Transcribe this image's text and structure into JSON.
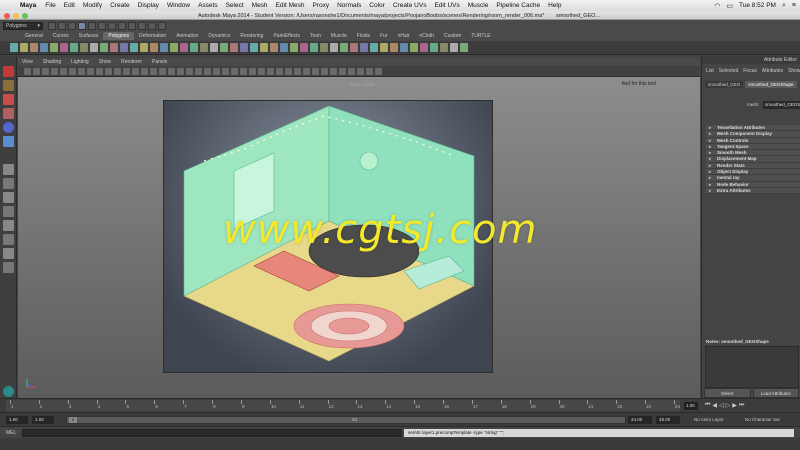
{
  "mac_menubar": {
    "app": "Maya",
    "items": [
      "File",
      "Edit",
      "Modify",
      "Create",
      "Display",
      "Window",
      "Assets",
      "Select",
      "Mesh",
      "Edit Mesh",
      "Proxy",
      "Normals",
      "Color",
      "Create UVs",
      "Edit UVs",
      "Muscle",
      "Pipeline Cache",
      "Help"
    ],
    "clock": "Tue 8:52 PM"
  },
  "window": {
    "title": "Autodesk Maya 2014 - Student Version: /Users/rasonshe1/Documents/maya/projects/PoojanoBoobs/scenes/Rendering/room_render_006.ma*",
    "title_suffix": "smoothed_GEO..."
  },
  "menuset": {
    "selected": "Polygons"
  },
  "shelf": {
    "tabs": [
      "General",
      "Curves",
      "Surfaces",
      "Polygons",
      "Deformation",
      "Animation",
      "Dynamics",
      "Rendering",
      "PaintEffects",
      "Toon",
      "Muscle",
      "Fluids",
      "Fur",
      "nHair",
      "nCloth",
      "Custom",
      "TURTLE"
    ],
    "active_tab": "Polygons"
  },
  "viewport": {
    "menu": [
      "View",
      "Shading",
      "Lighting",
      "Show",
      "Renderer",
      "Panels"
    ],
    "resolution": "1024 x 1024",
    "tool_hint": "fied for this tool",
    "watermark": "www.cgtsj.com"
  },
  "attribute_editor": {
    "title": "Attribute Editor",
    "menu": [
      "List",
      "Selected",
      "Focus",
      "Attributes",
      "Show"
    ],
    "tabs": [
      "smoothed_GEO",
      "smoothed_GEOShape"
    ],
    "active_tab": "smoothed_GEOShape",
    "mesh_label": "mesh:",
    "mesh_value": "smoothed_GEOSh",
    "sections": [
      "Tessellation Attributes",
      "Mesh Component Display",
      "Mesh Controls",
      "Tangent Space",
      "Smooth Mesh",
      "Displacement Map",
      "Render Stats",
      "Object Display",
      "mental ray",
      "Node Behavior",
      "Extra Attributes"
    ],
    "notes_label": "Notes:  smoothed_GEOShape",
    "select_button": "Select",
    "load_button": "Load Attributes"
  },
  "time_slider": {
    "tick_labels": [
      "1",
      "2",
      "3",
      "4",
      "5",
      "6",
      "7",
      "8",
      "9",
      "10",
      "11",
      "12",
      "13",
      "14",
      "15",
      "16",
      "17",
      "18",
      "19",
      "20",
      "21",
      "22",
      "23",
      "24"
    ],
    "current_frame": "1.00"
  },
  "range_slider": {
    "start": "1.00",
    "range_start": "1.00",
    "handle": "1",
    "range_mark": "24",
    "range_end": "24.00",
    "end": "48.00",
    "anim_layer": "No Anim Layer",
    "char_set": "No Character Set"
  },
  "command_line": {
    "label": "MEL",
    "output": "setAttr layer1.precompTemplate -type \"string\" \"\";"
  },
  "colors": {
    "accent_active_tab": "#666666",
    "watermark": "#f3e92a"
  }
}
